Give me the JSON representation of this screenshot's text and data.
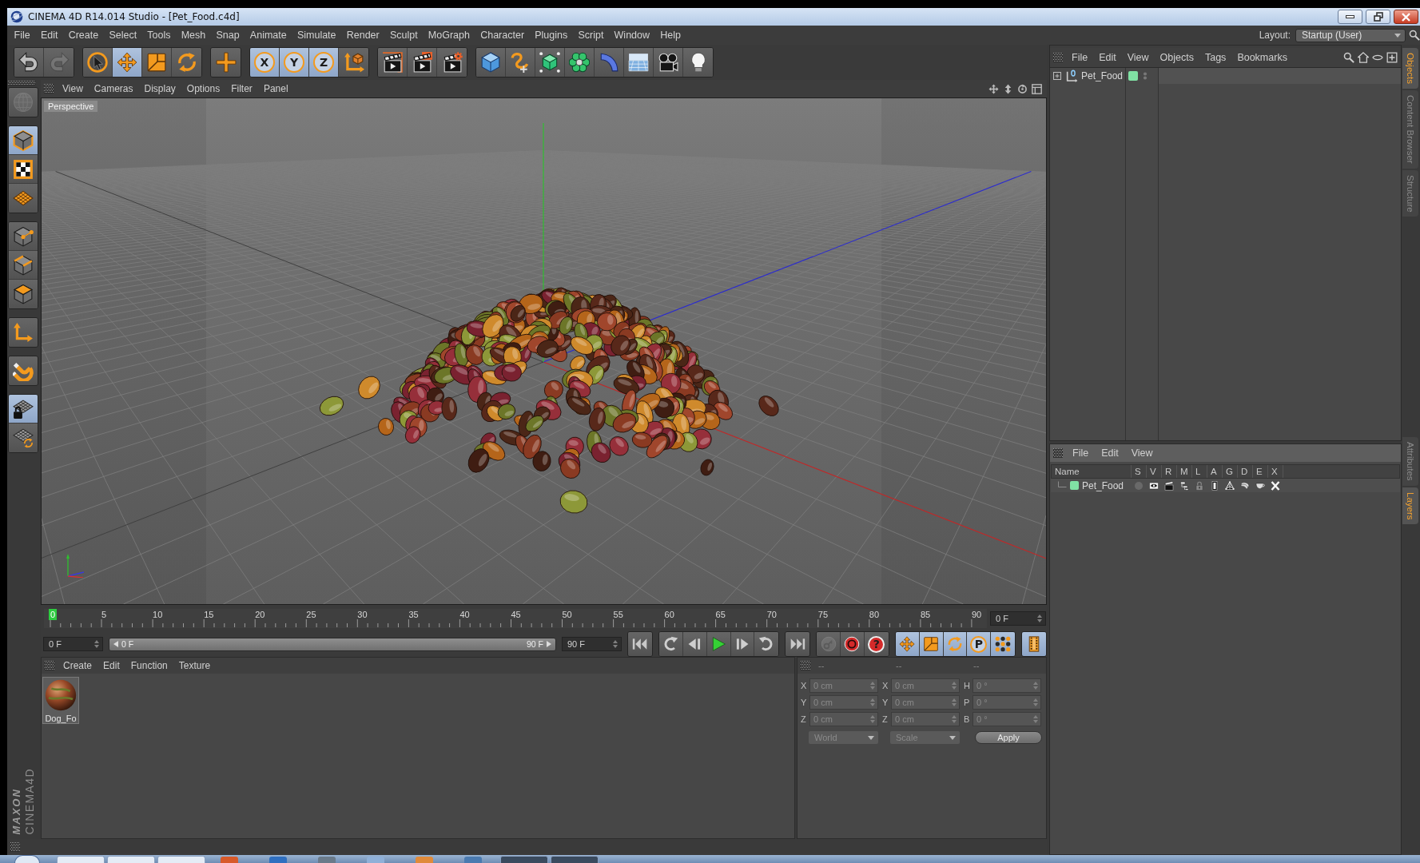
{
  "window": {
    "title": "CINEMA 4D R14.014 Studio - [Pet_Food.c4d]"
  },
  "menu_bar": {
    "items": [
      "File",
      "Edit",
      "Create",
      "Select",
      "Tools",
      "Mesh",
      "Snap",
      "Animate",
      "Simulate",
      "Render",
      "Sculpt",
      "MoGraph",
      "Character",
      "Plugins",
      "Script",
      "Window",
      "Help"
    ],
    "layout_label": "Layout:",
    "layout_value": "Startup (User)"
  },
  "toolbar": {
    "groups": [
      [
        {
          "kind": "undo",
          "selected": false,
          "disabled": false
        },
        {
          "kind": "redo",
          "selected": false,
          "disabled": true
        }
      ],
      [
        {
          "kind": "live-select",
          "selected": false,
          "disabled": false
        },
        {
          "kind": "move",
          "selected": true,
          "disabled": false
        },
        {
          "kind": "scale",
          "selected": false,
          "disabled": false
        },
        {
          "kind": "rotate",
          "selected": false,
          "disabled": false
        }
      ],
      [
        {
          "kind": "recent-tool",
          "selected": false,
          "disabled": false
        }
      ],
      [
        {
          "kind": "x-axis",
          "label": "X",
          "selected": true,
          "disabled": false
        },
        {
          "kind": "y-axis",
          "label": "Y",
          "selected": true,
          "disabled": false
        },
        {
          "kind": "z-axis",
          "label": "Z",
          "selected": true,
          "disabled": false
        },
        {
          "kind": "coordinate-system",
          "selected": false,
          "disabled": false
        }
      ],
      [
        {
          "kind": "render-view",
          "selected": false,
          "disabled": false
        },
        {
          "kind": "render-picture-viewer",
          "selected": false,
          "disabled": false
        },
        {
          "kind": "render-settings",
          "selected": false,
          "disabled": false
        }
      ],
      [
        {
          "kind": "cube",
          "selected": false,
          "disabled": false
        },
        {
          "kind": "spline-pen",
          "selected": false,
          "disabled": false
        },
        {
          "kind": "subdivision-surface",
          "selected": false,
          "disabled": false
        },
        {
          "kind": "cloner",
          "selected": false,
          "disabled": false
        },
        {
          "kind": "bend-deformer",
          "selected": false,
          "disabled": false
        },
        {
          "kind": "floor",
          "selected": false,
          "disabled": false
        },
        {
          "kind": "camera",
          "selected": false,
          "disabled": false
        },
        {
          "kind": "light",
          "selected": false,
          "disabled": false
        }
      ]
    ]
  },
  "tool_palette": {
    "groups": [
      [
        {
          "kind": "make-editable",
          "selected": false,
          "disabled": true
        }
      ],
      [
        {
          "kind": "model",
          "selected": true,
          "disabled": false
        },
        {
          "kind": "texture",
          "selected": false,
          "disabled": false
        },
        {
          "kind": "workplane",
          "selected": false,
          "disabled": false
        }
      ],
      [
        {
          "kind": "points",
          "selected": false,
          "disabled": false
        },
        {
          "kind": "edges",
          "selected": false,
          "disabled": false
        },
        {
          "kind": "polygons",
          "selected": false,
          "disabled": false
        }
      ],
      [
        {
          "kind": "axis",
          "selected": false,
          "disabled": false
        }
      ],
      [
        {
          "kind": "snap",
          "selected": false,
          "disabled": false
        }
      ],
      [
        {
          "kind": "lock-workplane",
          "selected": true,
          "disabled": false
        },
        {
          "kind": "planar-workplane",
          "selected": false,
          "disabled": false
        }
      ]
    ]
  },
  "brand": {
    "maker": "MAXON",
    "product": "CINEMA4D"
  },
  "viewport": {
    "menu": [
      "View",
      "Cameras",
      "Display",
      "Options",
      "Filter",
      "Panel"
    ],
    "camera_label": "Perspective"
  },
  "timeline": {
    "ticks": [
      {
        "label": "0",
        "selected": true
      },
      {
        "label": "5",
        "selected": false
      },
      {
        "label": "10",
        "selected": false
      },
      {
        "label": "15",
        "selected": false
      },
      {
        "label": "20",
        "selected": false
      },
      {
        "label": "25",
        "selected": false
      },
      {
        "label": "30",
        "selected": false
      },
      {
        "label": "35",
        "selected": false
      },
      {
        "label": "40",
        "selected": false
      },
      {
        "label": "45",
        "selected": false
      },
      {
        "label": "50",
        "selected": false
      },
      {
        "label": "55",
        "selected": false
      },
      {
        "label": "60",
        "selected": false
      },
      {
        "label": "65",
        "selected": false
      },
      {
        "label": "70",
        "selected": false
      },
      {
        "label": "75",
        "selected": false
      },
      {
        "label": "80",
        "selected": false
      },
      {
        "label": "85",
        "selected": false
      },
      {
        "label": "90",
        "selected": false
      }
    ],
    "frame_field": "0 F"
  },
  "transport": {
    "start_field": "0 F",
    "range_slider": {
      "start_label": "0 F",
      "end_label": "90 F",
      "level": 1
    },
    "end_field": "90 F",
    "groups": [
      [
        {
          "kind": "go-start",
          "selected": false,
          "disabled": false
        }
      ],
      [
        {
          "kind": "prev-key",
          "selected": false,
          "disabled": false
        },
        {
          "kind": "prev-frame",
          "selected": false,
          "disabled": false
        },
        {
          "kind": "play",
          "selected": false,
          "disabled": false
        },
        {
          "kind": "next-frame",
          "selected": false,
          "disabled": false
        },
        {
          "kind": "next-key",
          "selected": false,
          "disabled": false
        }
      ],
      [
        {
          "kind": "go-end",
          "selected": false,
          "disabled": false
        }
      ],
      [
        {
          "kind": "record",
          "selected": false,
          "disabled": true
        },
        {
          "kind": "autokey",
          "selected": false,
          "disabled": false
        },
        {
          "kind": "keyframe-selection",
          "label": "?",
          "selected": false,
          "disabled": false
        }
      ],
      [
        {
          "kind": "key-position",
          "selected": true,
          "disabled": false
        },
        {
          "kind": "key-scale",
          "selected": true,
          "disabled": false
        },
        {
          "kind": "key-rotation",
          "selected": true,
          "disabled": false
        },
        {
          "kind": "key-parameter",
          "label": "P",
          "selected": true,
          "disabled": false
        },
        {
          "kind": "key-point-level",
          "selected": true,
          "disabled": false
        }
      ],
      [
        {
          "kind": "timeline",
          "selected": true,
          "disabled": false
        }
      ]
    ]
  },
  "material_manager": {
    "menu": [
      "Create",
      "Edit",
      "Function",
      "Texture"
    ],
    "materials": [
      {
        "name": "Dog_Fo"
      }
    ]
  },
  "coordinates": {
    "headers": [
      "--",
      "--",
      "--"
    ],
    "rows": [
      [
        {
          "label": "X",
          "value": "0 cm",
          "disabled": true
        },
        {
          "label": "X",
          "value": "0 cm",
          "disabled": true
        },
        {
          "label": "H",
          "value": "0 °",
          "disabled": true
        }
      ],
      [
        {
          "label": "Y",
          "value": "0 cm",
          "disabled": true
        },
        {
          "label": "Y",
          "value": "0 cm",
          "disabled": true
        },
        {
          "label": "P",
          "value": "0 °",
          "disabled": true
        }
      ],
      [
        {
          "label": "Z",
          "value": "0 cm",
          "disabled": true
        },
        {
          "label": "Z",
          "value": "0 cm",
          "disabled": true
        },
        {
          "label": "B",
          "value": "0 °",
          "disabled": true
        }
      ]
    ],
    "dropdowns": [
      {
        "value": "World",
        "disabled": true
      },
      {
        "value": "Scale",
        "disabled": true
      }
    ],
    "apply_button": "Apply"
  },
  "object_manager": {
    "menu": [
      "File",
      "Edit",
      "View",
      "Objects",
      "Tags",
      "Bookmarks"
    ],
    "objects": [
      {
        "name": "Pet_Food",
        "expanded": false,
        "color": "#80e2a4"
      }
    ]
  },
  "side_tabs": {
    "top": [
      {
        "label": "Objects",
        "selected": true
      },
      {
        "label": "Content Browser",
        "selected": false
      },
      {
        "label": "Structure",
        "selected": false
      }
    ],
    "bottom": [
      {
        "label": "Attributes",
        "selected": false
      },
      {
        "label": "Layers",
        "selected": true
      }
    ]
  },
  "layer_manager": {
    "menu": [
      "File",
      "Edit",
      "View"
    ],
    "columns": [
      "Name",
      "S",
      "V",
      "R",
      "M",
      "L",
      "A",
      "G",
      "D",
      "E",
      "X"
    ],
    "layers": [
      {
        "name": "Pet_Food",
        "color": "#80e2a4",
        "flags": [
          {
            "kind": "solo",
            "on": false
          },
          {
            "kind": "view",
            "on": true
          },
          {
            "kind": "render",
            "on": true
          },
          {
            "kind": "manager",
            "on": true
          },
          {
            "kind": "locked",
            "on": false
          },
          {
            "kind": "animation",
            "on": true
          },
          {
            "kind": "generators",
            "on": true
          },
          {
            "kind": "deformers",
            "on": true
          },
          {
            "kind": "expressions",
            "on": true
          },
          {
            "kind": "xref",
            "on": true
          }
        ]
      }
    ]
  }
}
